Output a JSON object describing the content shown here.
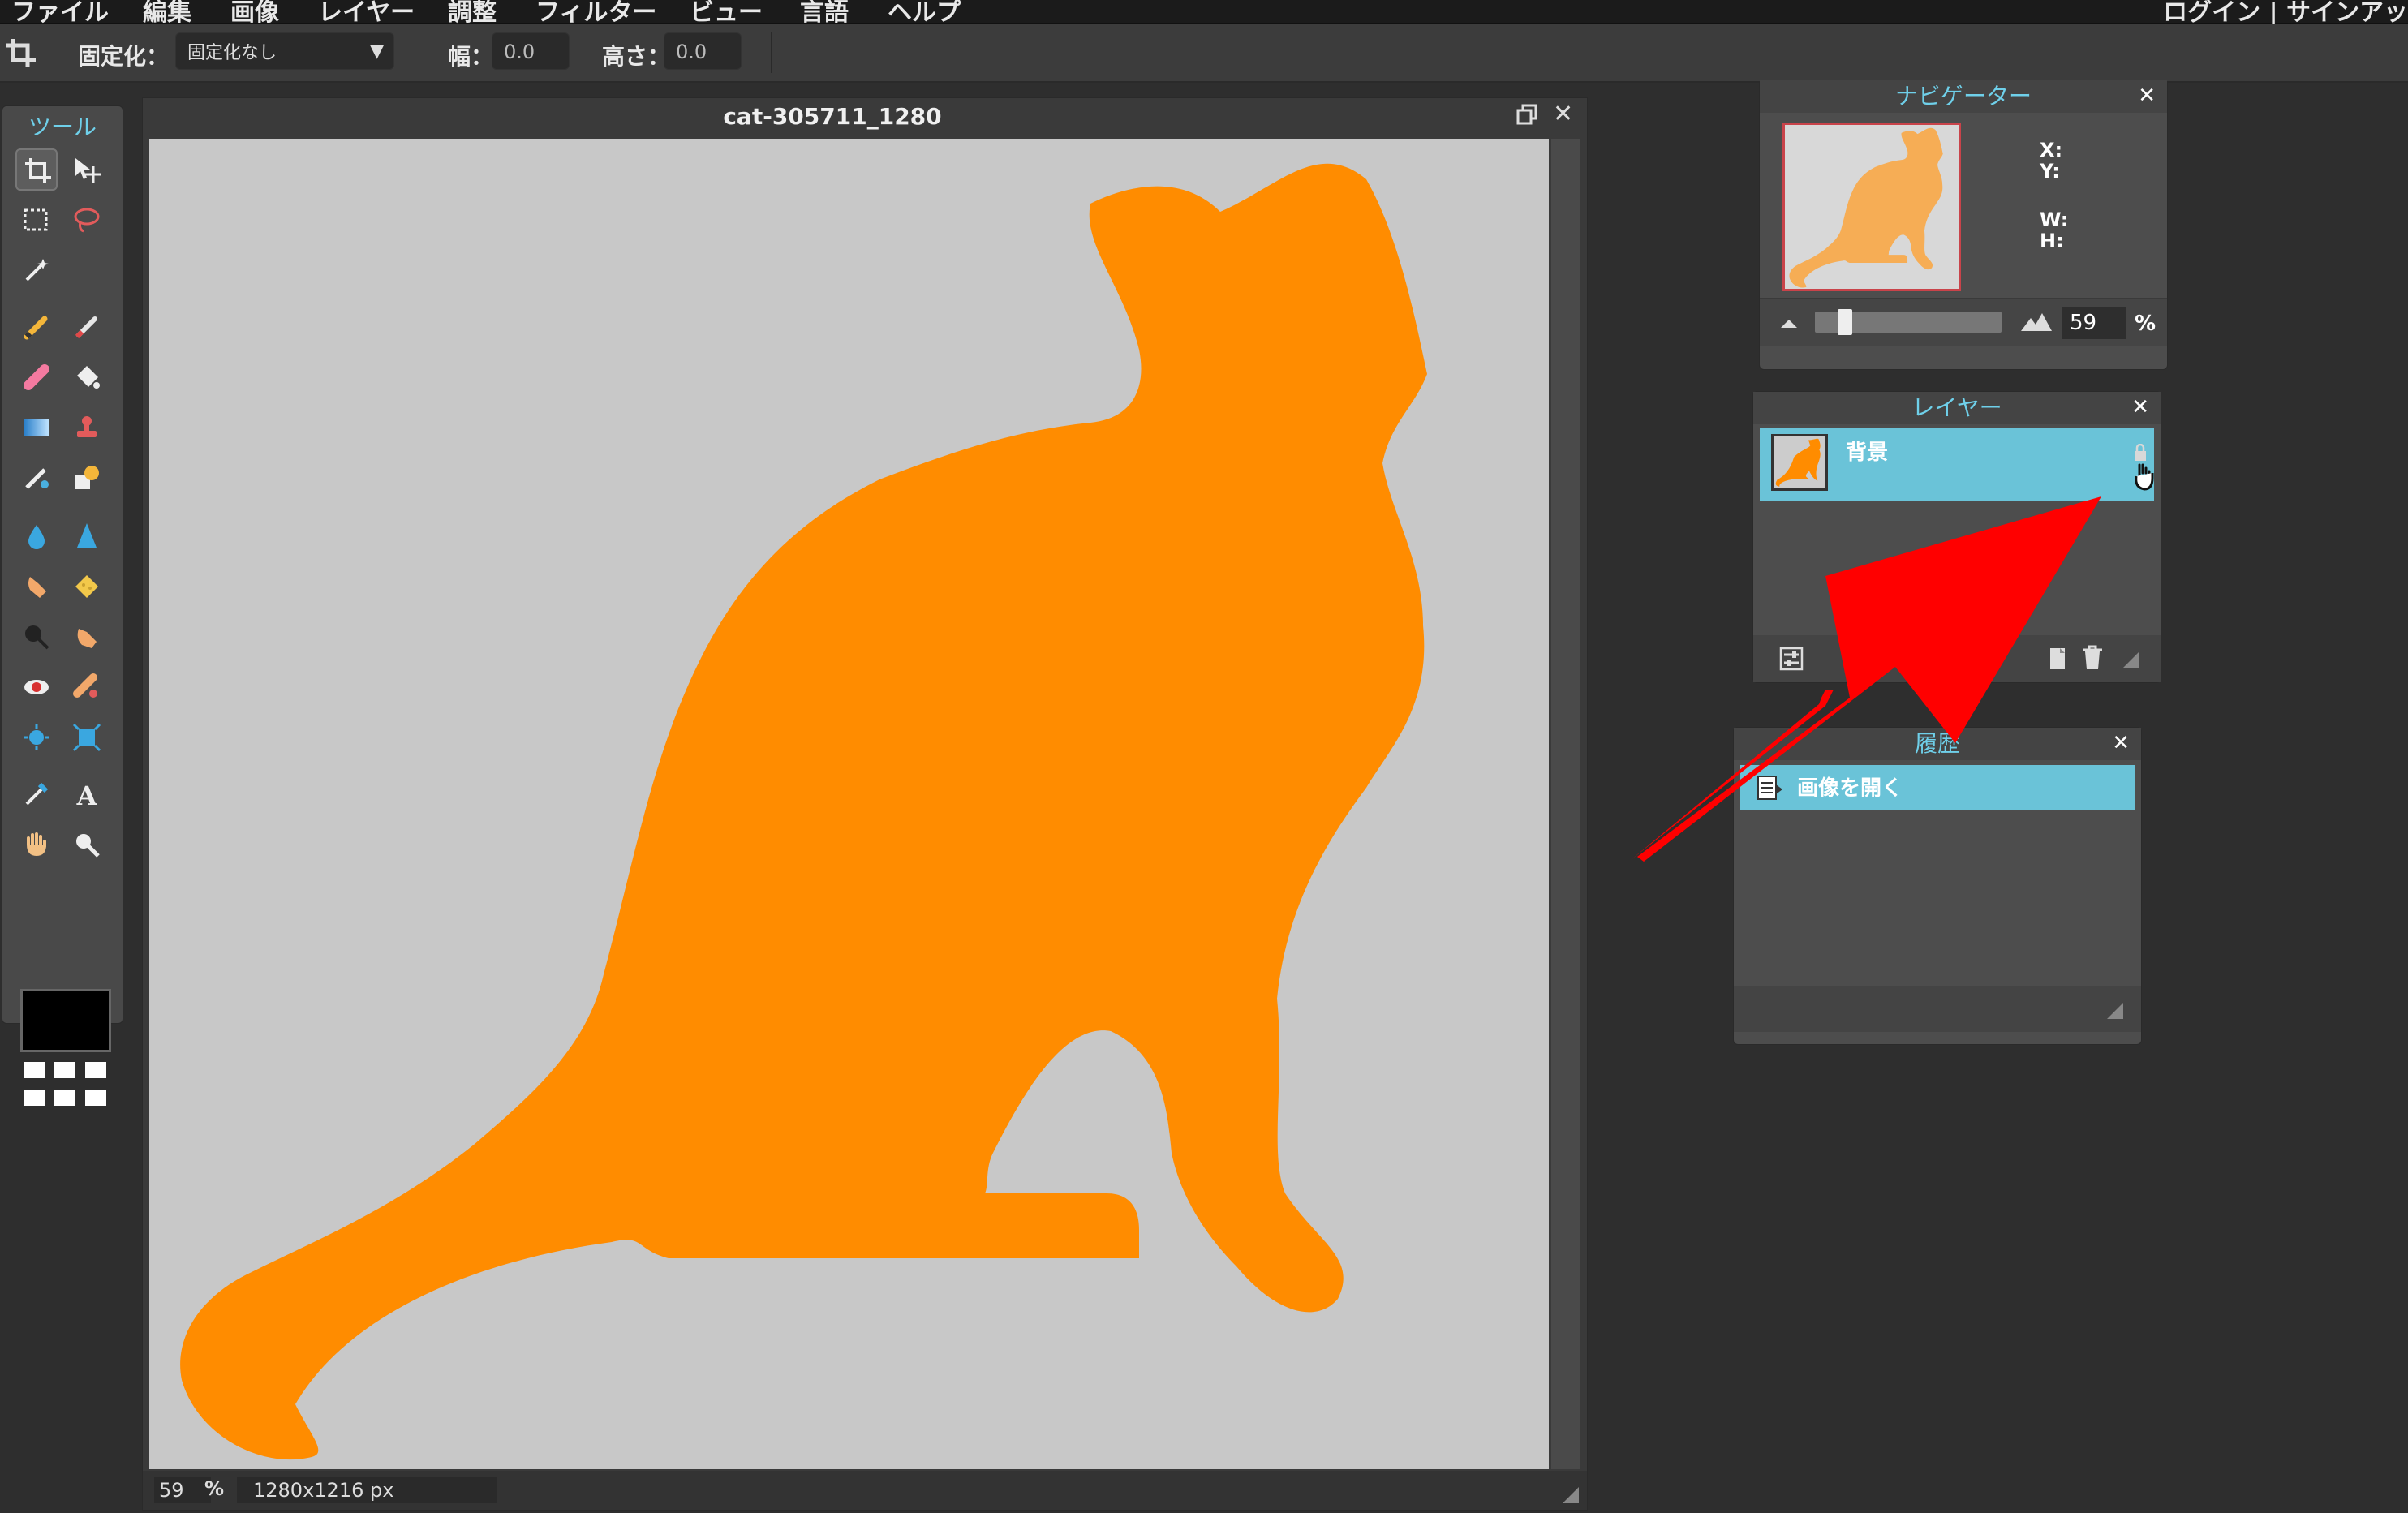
{
  "menu": {
    "items": [
      "ファイル",
      "編集",
      "画像",
      "レイヤー",
      "調整",
      "フィルター",
      "ビュー",
      "言語",
      "ヘルプ"
    ],
    "auth": "ログイン | サインアッ"
  },
  "options": {
    "fix_label": "固定化：",
    "fix_value": "固定化なし",
    "width_label": "幅：",
    "width_value": "0.0",
    "height_label": "高さ：",
    "height_value": "0.0"
  },
  "tools": {
    "title": "ツール"
  },
  "canvas": {
    "title": "cat-305711_1280",
    "zoom": "59",
    "zoom_unit": "%",
    "dimensions": "1280x1216 px",
    "background_color": "#c8c8c8",
    "silhouette_color": "#ff8c00"
  },
  "navigator": {
    "title": "ナビゲーター",
    "x_label": "X:",
    "y_label": "Y:",
    "w_label": "W:",
    "h_label": "H:",
    "zoom": "59",
    "zoom_unit": "%"
  },
  "layers": {
    "title": "レイヤー",
    "items": [
      {
        "name": "背景"
      }
    ]
  },
  "history": {
    "title": "履歴",
    "items": [
      {
        "label": "画像を開く"
      }
    ]
  },
  "colors": {
    "accent": "#6ac3d8",
    "arrow": "#ff0000"
  }
}
